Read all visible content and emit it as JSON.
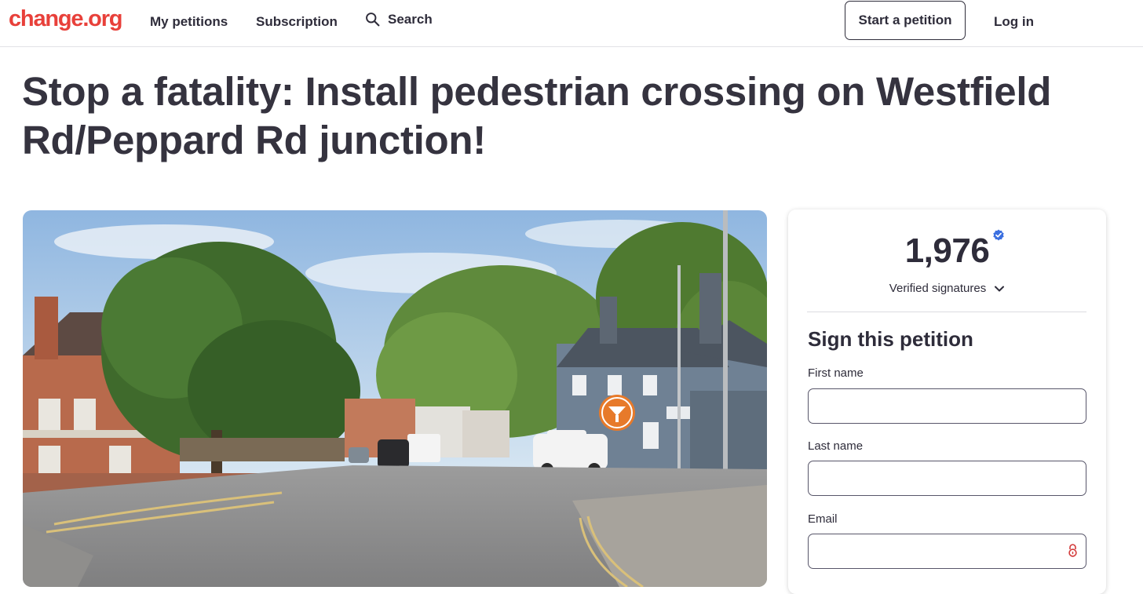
{
  "header": {
    "logo": "change.org",
    "nav": {
      "my_petitions": "My petitions",
      "subscription": "Subscription",
      "search": "Search"
    },
    "start_petition": "Start a petition",
    "login": "Log in"
  },
  "petition": {
    "title": "Stop a fatality: Install pedestrian crossing on Westfield Rd/Peppard Rd junction!"
  },
  "signatures": {
    "count": "1,976",
    "verified_label": "Verified signatures"
  },
  "sign_form": {
    "title": "Sign this petition",
    "first_name_label": "First name",
    "first_name_value": "",
    "last_name_label": "Last name",
    "last_name_value": "",
    "email_label": "Email",
    "email_value": ""
  },
  "colors": {
    "brand": "#e8403a",
    "text": "#2e2c3a",
    "verified": "#3b6fe0"
  },
  "icons": [
    "search-icon",
    "verified-badge-icon",
    "chevron-down-icon",
    "password-manager-icon"
  ]
}
